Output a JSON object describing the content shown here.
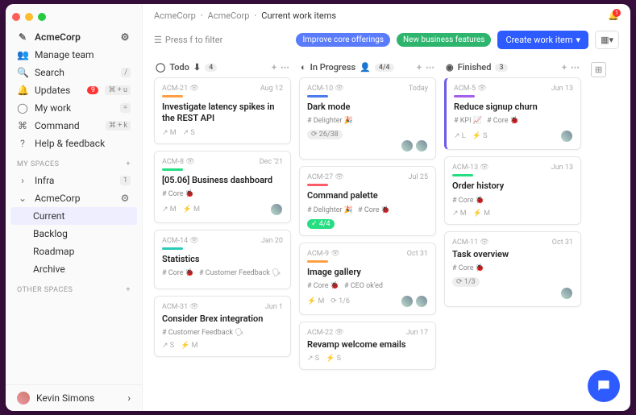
{
  "breadcrumb": [
    "AcmeCorp",
    "AcmeCorp",
    "Current work items"
  ],
  "filter_hint": "Press f to filter",
  "pills": {
    "improve": "Improve core offerings",
    "newbiz": "New business features"
  },
  "create_btn": "Create work item",
  "notif_count": "1",
  "sidebar": {
    "org": "AcmeCorp",
    "items": [
      {
        "icon": "👥",
        "label": "Manage team"
      },
      {
        "icon": "🔍",
        "label": "Search",
        "shortcut": "/"
      },
      {
        "icon": "🔔",
        "label": "Updates",
        "badge": "9",
        "shortcut": "⌘ + u"
      },
      {
        "icon": "◯",
        "label": "My work",
        "shortcut": "="
      },
      {
        "icon": "⌘",
        "label": "Command",
        "shortcut": "⌘ + k"
      },
      {
        "icon": "?",
        "label": "Help & feedback"
      }
    ],
    "spaces_hdr": "MY SPACES",
    "spaces": [
      {
        "label": "Infra",
        "count": "1",
        "chev": "›"
      },
      {
        "label": "AcmeCorp",
        "chev": "⌄",
        "gear": true,
        "children": [
          "Current",
          "Backlog",
          "Roadmap",
          "Archive"
        ]
      }
    ],
    "other_hdr": "OTHER SPACES",
    "user": "Kevin Simons"
  },
  "columns": [
    {
      "name": "Todo",
      "icon": "◯",
      "count": "4",
      "extra": "⬇",
      "cards": [
        {
          "id": "ACM-21",
          "date": "Aug 12",
          "bar": "bar-orange",
          "title": "Investigate latency spikes in the REST API",
          "tags": [],
          "foot": [
            "↗ M",
            "↗ S"
          ]
        },
        {
          "id": "ACM-8",
          "date": "Dec '21",
          "bar": "bar-green",
          "title": "[05.06] Business dashboard",
          "tags": [
            "# Core 🐞"
          ],
          "foot": [
            "↗ M",
            "⚡ M"
          ],
          "avatars": 1
        },
        {
          "id": "ACM-14",
          "date": "Jan 20",
          "bar": "bar-teal",
          "title": "Statistics",
          "tags": [
            "# Core 🐞",
            "# Customer Feedback 🗣"
          ],
          "foot": []
        },
        {
          "id": "ACM-31",
          "date": "Jun 1",
          "title": "Consider Brex integration",
          "tags": [
            "# Customer Feedback 🗣"
          ],
          "foot": [
            "↗ S",
            "⚡ M"
          ]
        }
      ]
    },
    {
      "name": "In Progress",
      "icon": "◐",
      "count": "4/4",
      "extra": "👤",
      "cards": [
        {
          "id": "ACM-10",
          "date": "Today",
          "bar": "bar-blue",
          "title": "Dark mode",
          "tags": [
            "# Delighter 🎉"
          ],
          "prog": "⟳ 26/38",
          "avatars": 2
        },
        {
          "id": "ACM-27",
          "date": "Jul 25",
          "bar": "bar-red",
          "title": "Command palette",
          "tags": [
            "# Delighter 🎉",
            "# Core 🐞"
          ],
          "prog_done": "✓ 4/4"
        },
        {
          "id": "ACM-9",
          "date": "Oct 31",
          "bar": "bar-orange",
          "title": "Image gallery",
          "tags": [
            "# Core 🐞",
            "# CEO ok'ed"
          ],
          "foot": [
            "⚡ M",
            "⟳ 1/6"
          ],
          "avatars": 2
        },
        {
          "id": "ACM-22",
          "date": "Jun 17",
          "title": "Revamp welcome emails",
          "foot": [
            "↗ S",
            "⚡ S"
          ]
        }
      ]
    },
    {
      "name": "Finished",
      "icon": "◉",
      "count": "3",
      "cards": [
        {
          "id": "ACM-5",
          "date": "Jun 13",
          "bar": "bar-purple",
          "title": "Reduce signup churn",
          "tags": [
            "# KPI 📈",
            "# Core 🐞"
          ],
          "foot": [
            "↗ L",
            "⚡ S"
          ],
          "avatars": 1,
          "accent": true
        },
        {
          "id": "ACM-13",
          "date": "Jun 13",
          "bar": "bar-green",
          "title": "Order history",
          "tags": [
            "# Core 🐞"
          ],
          "foot": [
            "↗ M",
            "⚡ M"
          ]
        },
        {
          "id": "ACM-11",
          "date": "Oct 31",
          "title": "Task overview",
          "tags": [
            "# Core 🐞"
          ],
          "prog": "⟳ 1/3",
          "avatars": 1
        }
      ]
    }
  ]
}
